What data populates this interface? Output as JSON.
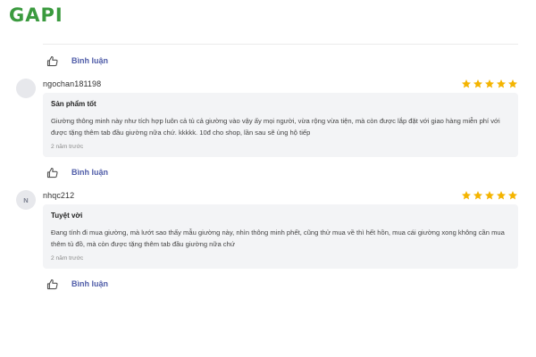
{
  "brand": {
    "name": "GAPI",
    "color": "#3a9a3e"
  },
  "actions": {
    "comment_label": "Bình luận",
    "like_icon": "thumbs-up-icon"
  },
  "star_color": "#f4b400",
  "reviews": [
    {
      "username": "ngochan181198",
      "avatar_letter": "",
      "rating": 5,
      "title": "Sản phẩm tốt",
      "body": "Giường thông minh này như tích hợp luôn cả tủ cả giường vào vậy ấy mọi người, vừa rộng vừa tiện, mà còn được lắp đặt với giao hàng miễn phí với được tặng thêm tab đầu giường nữa chứ. kkkkk. 10đ cho shop, lần sau sẽ ủng hộ tiếp",
      "time": "2 năm trước"
    },
    {
      "username": "nhqc212",
      "avatar_letter": "N",
      "rating": 5,
      "title": "Tuyệt vời",
      "body": "Đang tính đi mua giường, mà lướt sao thấy mẫu giường này, nhìn thông minh phết, cũng thử mua về thì hết hồn, mua cái giường xong không cần mua thêm tủ đồ, mà còn được tặng thêm tab đầu giường nữa chứ",
      "time": "2 năm trước"
    }
  ]
}
